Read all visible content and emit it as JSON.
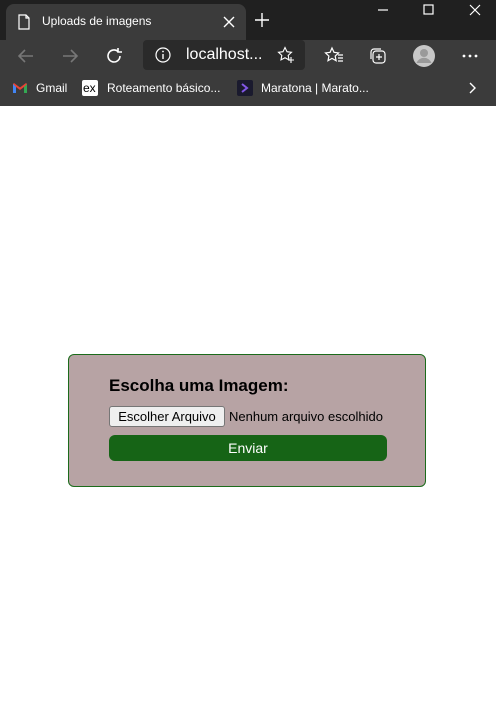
{
  "browser": {
    "tab": {
      "title": "Uploads de imagens"
    },
    "address": {
      "url": "localhost..."
    },
    "bookmarks": [
      {
        "label": "Gmail",
        "icon": "gmail-icon"
      },
      {
        "label": "Roteamento básico...",
        "icon": "ex-icon",
        "icon_text": "ex"
      },
      {
        "label": "Maratona | Marato...",
        "icon": "maratona-icon"
      }
    ]
  },
  "form": {
    "heading": "Escolha uma Imagem:",
    "file_button": "Escolher Arquivo",
    "no_file_text": "Nenhum arquivo escolhido",
    "submit": "Enviar"
  },
  "colors": {
    "panel_bg": "#b7a3a4",
    "panel_border": "#1b6b1b",
    "submit_bg": "#166416",
    "browser_chrome": "#3b3b3b",
    "tabstrip": "#202020"
  }
}
